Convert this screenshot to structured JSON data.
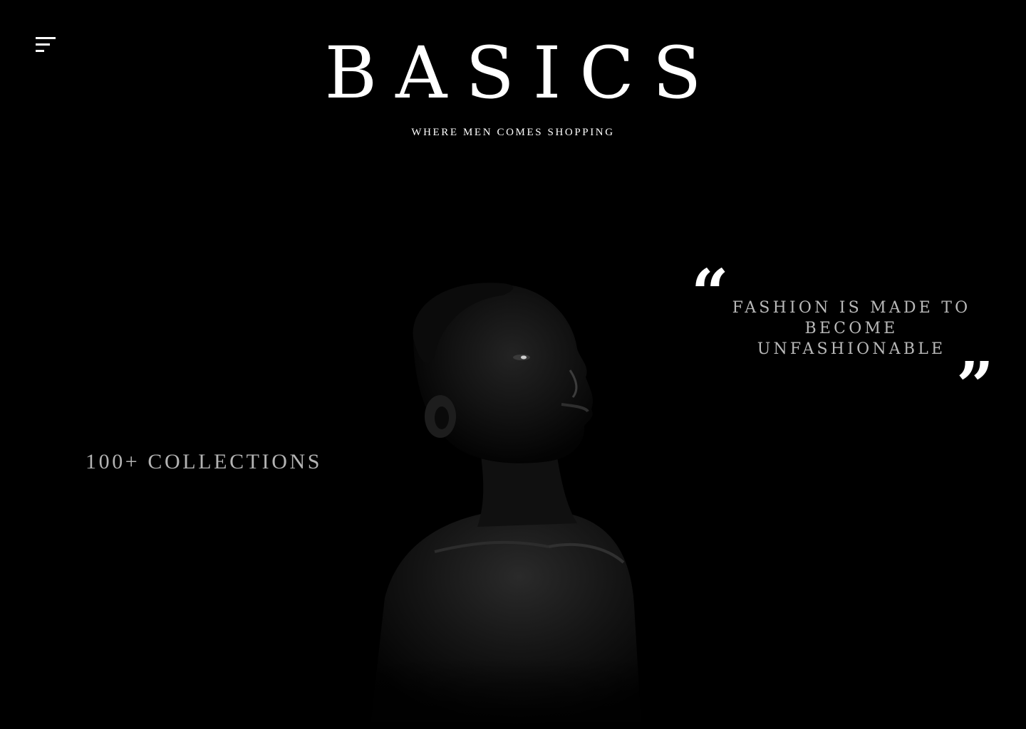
{
  "header": {
    "brand": "BASICS",
    "tagline": "WHERE MEN COMES SHOPPING",
    "menu_icon": "menu-icon"
  },
  "hero": {
    "image": "portrait-photo"
  },
  "quote": {
    "open_mark": "“",
    "text": "FASHION IS MADE TO BECOME UNFASHIONABLE",
    "close_mark": "”"
  },
  "stats": {
    "collections": "100+ COLLECTIONS"
  },
  "colors": {
    "background": "#000000",
    "primary_text": "#ffffff",
    "muted_text": "#b9b9b9"
  }
}
